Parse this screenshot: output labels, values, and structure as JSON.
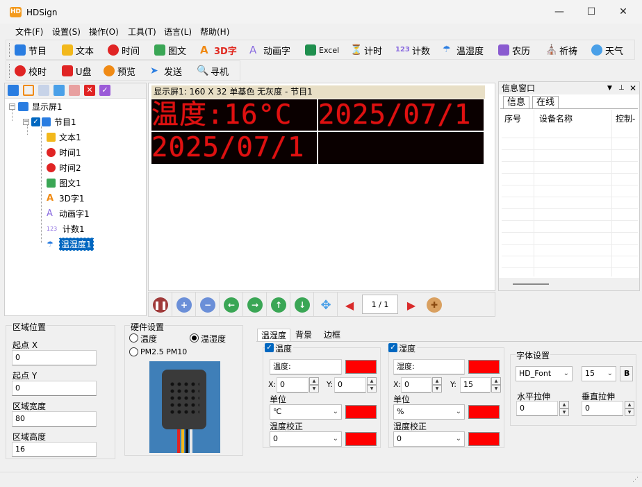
{
  "window": {
    "title": "HDSign",
    "logo": "HD"
  },
  "menu": [
    "文件(F)",
    "设置(S)",
    "操作(O)",
    "工具(T)",
    "语言(L)",
    "帮助(H)"
  ],
  "toolbar1": [
    "节目",
    "文本",
    "时间",
    "图文",
    "3D字",
    "动画字",
    "Excel",
    "计时",
    "计数",
    "温湿度",
    "农历",
    "祈祷",
    "天气"
  ],
  "toolbar1_num_label": "123",
  "toolbar2": [
    "校时",
    "U盘",
    "预览",
    "发送",
    "寻机"
  ],
  "tree": {
    "screen": "显示屏1",
    "program": "节目1",
    "items": [
      "文本1",
      "时间1",
      "时间2",
      "图文1",
      "3D字1",
      "动画字1",
      "计数1",
      "温湿度1"
    ],
    "counter_icon_label": "123"
  },
  "preview": {
    "caption": "显示屏1: 160 X 32  单基色 无灰度 - 节目1",
    "led1": "温度:16°C",
    "led2": "2025/07/1",
    "led3": "2025/07/1"
  },
  "playbar": {
    "page": "1 / 1"
  },
  "info": {
    "title": "信息窗口",
    "tabs": [
      "信息",
      "在线"
    ],
    "columns": [
      "序号",
      "设备名称",
      "控制-"
    ]
  },
  "region": {
    "title": "区域位置",
    "start_x_label": "起点 X",
    "start_x": "0",
    "start_y_label": "起点 Y",
    "start_y": "0",
    "width_label": "区域宽度",
    "width": "80",
    "height_label": "区域高度",
    "height": "16"
  },
  "hardware": {
    "title": "硬件设置",
    "opt_temp": "温度",
    "opt_temphum": "温湿度",
    "opt_pm": "PM2.5 PM10"
  },
  "temphum_tabs": [
    "温湿度",
    "背景",
    "边框"
  ],
  "temp": {
    "check_label": "温度",
    "prefix": "温度:",
    "x_label": "X:",
    "x": "0",
    "y_label": "Y:",
    "y": "0",
    "unit_label": "单位",
    "unit": "℃",
    "calib_label": "温度校正",
    "calib": "0",
    "color": "#ff0000"
  },
  "hum": {
    "check_label": "湿度",
    "prefix": "湿度:",
    "x_label": "X:",
    "x": "0",
    "y_label": "Y:",
    "y": "15",
    "unit_label": "单位",
    "unit": "%",
    "calib_label": "湿度校正",
    "calib": "0",
    "color": "#ff0000"
  },
  "font": {
    "title": "字体设置",
    "name": "HD_Font",
    "size": "15",
    "bold": "B",
    "hstretch_label": "水平拉伸",
    "hstretch": "0",
    "vstretch_label": "垂直拉伸",
    "vstretch": "0"
  }
}
